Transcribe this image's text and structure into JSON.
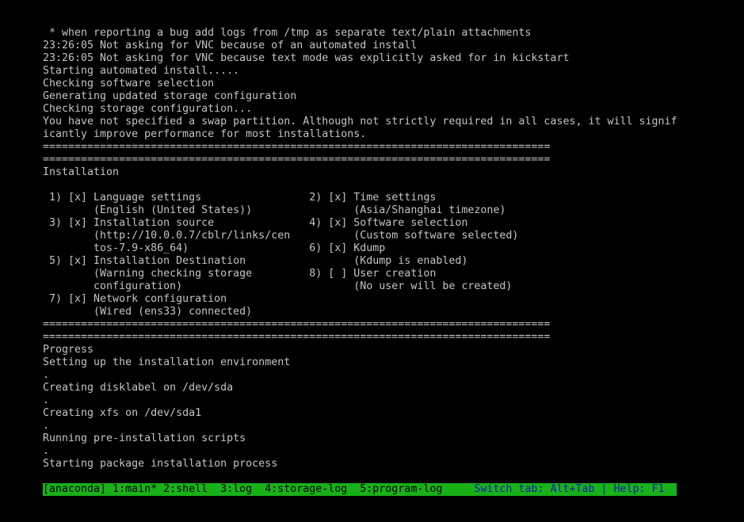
{
  "lines": [
    " * when reporting a bug add logs from /tmp as separate text/plain attachments",
    "23:26:05 Not asking for VNC because of an automated install",
    "23:26:05 Not asking for VNC because text mode was explicitly asked for in kickstart",
    "Starting automated install.....",
    "Checking software selection",
    "Generating updated storage configuration",
    "Checking storage configuration...",
    "You have not specified a swap partition. Although not strictly required in all cases, it will signif",
    "icantly improve performance for most installations.",
    "================================================================================",
    "================================================================================",
    "Installation",
    "",
    " 1) [x] Language settings                 2) [x] Time settings",
    "        (English (United States))                (Asia/Shanghai timezone)",
    " 3) [x] Installation source               4) [x] Software selection",
    "        (http://10.0.0.7/cblr/links/cen          (Custom software selected)",
    "        tos-7.9-x86_64)                   6) [x] Kdump",
    " 5) [x] Installation Destination                 (Kdump is enabled)",
    "        (Warning checking storage         8) [ ] User creation",
    "        configuration)                           (No user will be created)",
    " 7) [x] Network configuration",
    "        (Wired (ens33) connected)",
    "================================================================================",
    "================================================================================",
    "Progress",
    "Setting up the installation environment",
    ".",
    "Creating disklabel on /dev/sda",
    ".",
    "Creating xfs on /dev/sda1",
    ".",
    "Running pre-installation scripts",
    ".",
    "Starting package installation process"
  ],
  "status_bar": {
    "tabs": "[anaconda] 1:main* 2:shell  3:log  4:storage-log  5:program-log     ",
    "hint": "Switch tab: Alt+Tab | Help: F1"
  },
  "colors": {
    "background": "#000000",
    "text": "#c4c4c4",
    "status_bg": "#18b218",
    "status_hint": "#1a1ab2"
  }
}
